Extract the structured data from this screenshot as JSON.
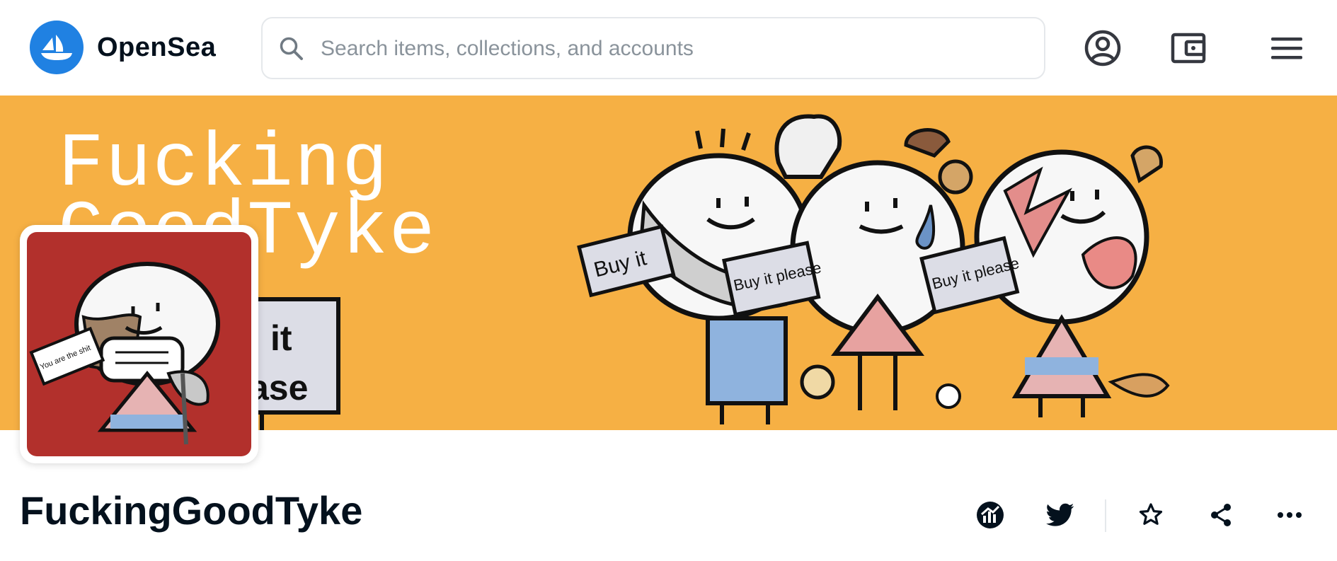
{
  "header": {
    "brand": "OpenSea",
    "search": {
      "placeholder": "Search items, collections, and accounts",
      "value": ""
    },
    "icons": [
      "account-icon",
      "wallet-icon",
      "menu-icon"
    ]
  },
  "banner": {
    "title_line1": "Fucking",
    "title_line2": "GoodTyke",
    "sign_left": "Buy it",
    "sign_middle": "Buy it please",
    "sign_right": "Buy it please",
    "sign_partial": "it",
    "sign_partial2": "ase"
  },
  "avatar": {
    "sign_text": "You are the shit"
  },
  "collection": {
    "name": "FuckingGoodTyke",
    "actions": [
      "stats-icon",
      "twitter-icon",
      "star-icon",
      "share-icon",
      "more-icon"
    ]
  },
  "colors": {
    "brand_blue": "#2081e2",
    "banner_bg": "#f6b044",
    "avatar_bg": "#b2302c",
    "text": "#04111d"
  }
}
